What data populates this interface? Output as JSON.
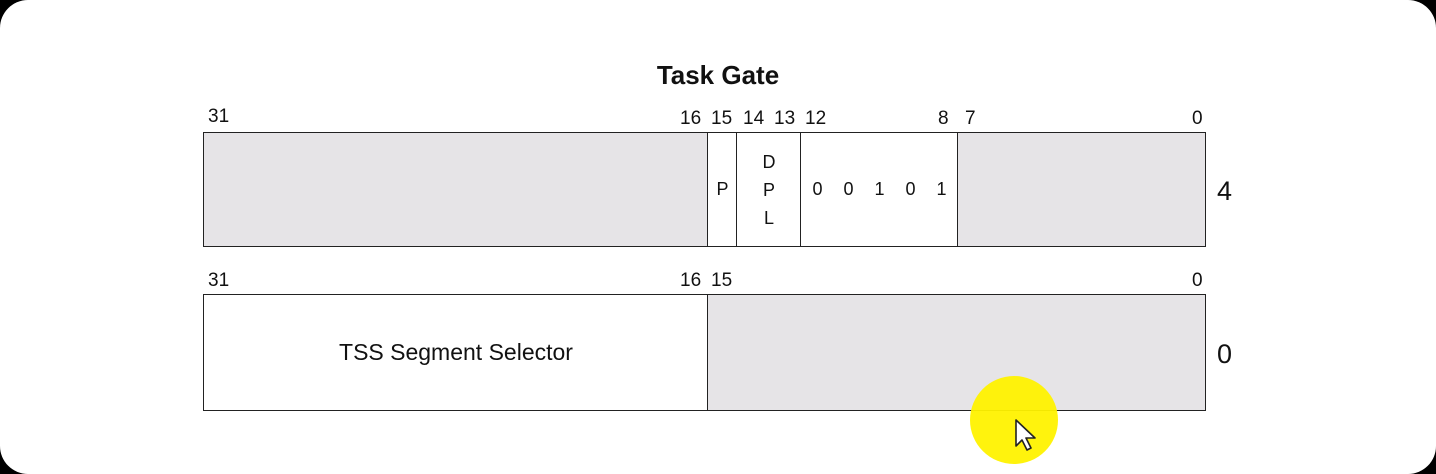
{
  "title": "Task Gate",
  "upper_dword": {
    "bit_labels": [
      "31",
      "16",
      "15",
      "14",
      "13",
      "12",
      "8",
      "7",
      "0"
    ],
    "fields": {
      "p": "P",
      "dpl": [
        "D",
        "P",
        "L"
      ],
      "type_bits": [
        "0",
        "0",
        "1",
        "0",
        "1"
      ]
    },
    "offset": "4"
  },
  "lower_dword": {
    "bit_labels": [
      "31",
      "16",
      "15",
      "0"
    ],
    "fields": {
      "selector": "TSS Segment Selector"
    },
    "offset": "0"
  },
  "colors": {
    "reserved_fill": "#e6e4e7",
    "cursor_highlight": "#fff200"
  },
  "icons": [
    "cursor-arrow-icon"
  ]
}
